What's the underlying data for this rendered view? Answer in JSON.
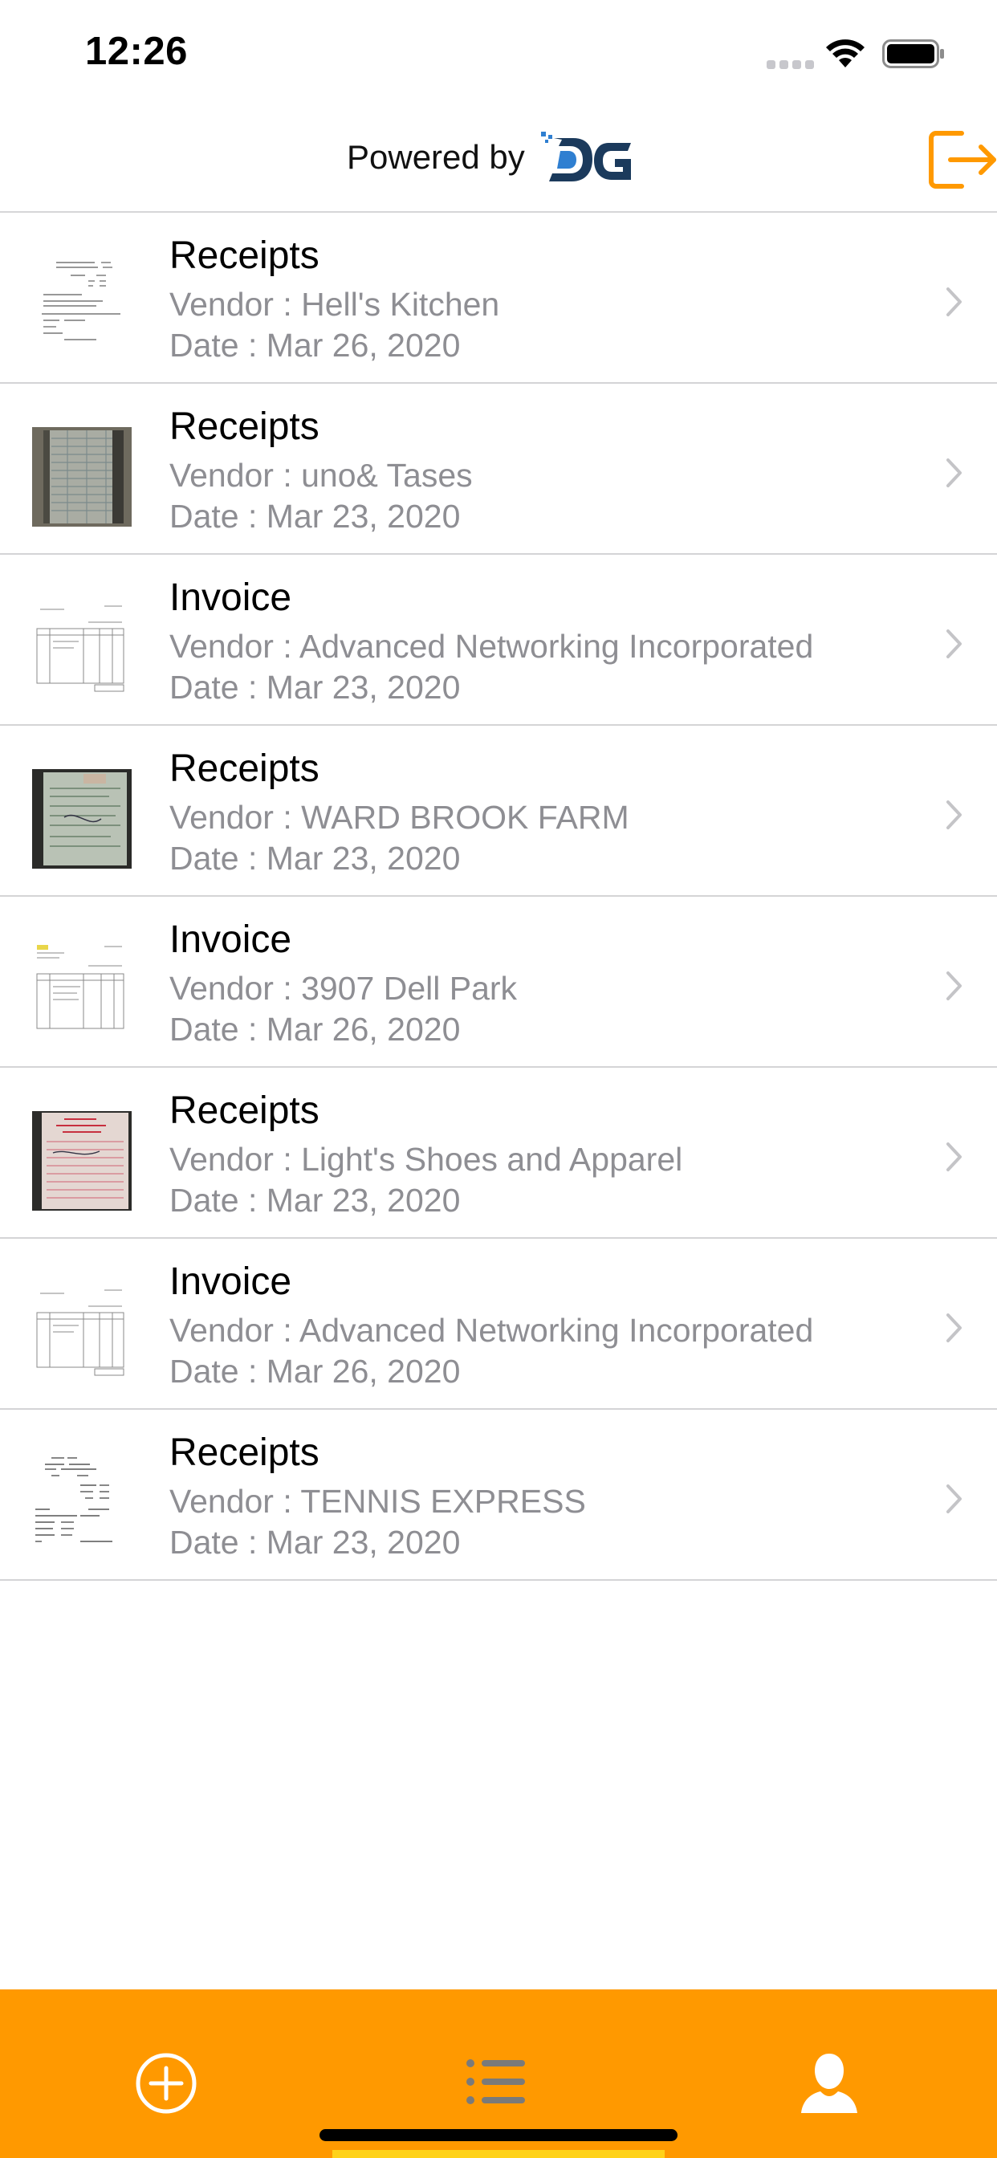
{
  "status_bar": {
    "time": "12:26"
  },
  "header": {
    "powered_by": "Powered by",
    "logo": "DG",
    "logout_icon": "logout-icon"
  },
  "colors": {
    "accent": "#ff9900",
    "logo_dark": "#1b3a5c",
    "logo_light": "#2f7fd1",
    "secondary_text": "#8e8e93",
    "separator": "#d4d4d6"
  },
  "documents": [
    {
      "title": "Receipts",
      "vendor": "Vendor : Hell's Kitchen",
      "date": "Date : Mar 26, 2020",
      "thumb": "receipt-paper-white"
    },
    {
      "title": "Receipts",
      "vendor": "Vendor : uno& Tases",
      "date": "Date : Mar 23, 2020",
      "thumb": "receipt-photo-grid"
    },
    {
      "title": "Invoice",
      "vendor": "Vendor : Advanced Networking Incorporated",
      "date": "Date : Mar 23, 2020",
      "thumb": "invoice-form"
    },
    {
      "title": "Receipts",
      "vendor": "Vendor : WARD BROOK FARM",
      "date": "Date : Mar 23, 2020",
      "thumb": "receipt-photo-green"
    },
    {
      "title": "Invoice",
      "vendor": "Vendor : 3907 Dell Park",
      "date": "Date : Mar 26, 2020",
      "thumb": "invoice-form-yellow"
    },
    {
      "title": "Receipts",
      "vendor": "Vendor : Light's Shoes and Apparel",
      "date": "Date : Mar 23, 2020",
      "thumb": "receipt-photo-red"
    },
    {
      "title": "Invoice",
      "vendor": "Vendor : Advanced Networking Incorporated",
      "date": "Date : Mar 26, 2020",
      "thumb": "invoice-form"
    },
    {
      "title": "Receipts",
      "vendor": "Vendor : TENNIS EXPRESS",
      "date": "Date : Mar 23, 2020",
      "thumb": "receipt-paper-print"
    }
  ],
  "tab_bar": {
    "tabs": [
      {
        "icon": "add-circle-icon"
      },
      {
        "icon": "list-icon",
        "selected": true
      },
      {
        "icon": "profile-icon"
      }
    ]
  }
}
